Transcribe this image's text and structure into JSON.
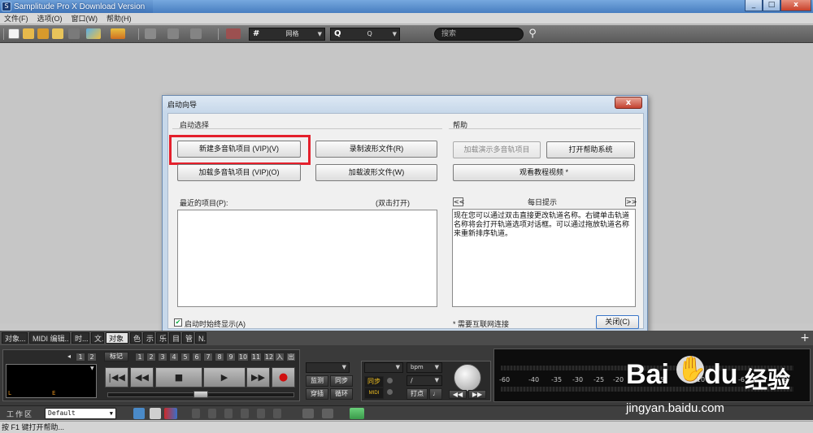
{
  "window": {
    "title": "Samplitude Pro X Download Version",
    "controls": [
      "_",
      "□",
      "x"
    ]
  },
  "menu": [
    "文件(F)",
    "选项(O)",
    "窗口(W)",
    "帮助(H)"
  ],
  "toolbar": {
    "grid_label": "网格",
    "grid_glyph": "#",
    "quantize_label": "Q",
    "quantize_glyph": "Q",
    "search_placeholder": "搜索"
  },
  "dialog": {
    "title": "启动向导",
    "close_label": "x",
    "start_group": "启动选择",
    "help_group": "帮助",
    "buttons": {
      "new_multitrack": "新建多音轨项目 (VIP)(V)",
      "record_wave": "录制波形文件(R)",
      "load_multitrack": "加载多音轨项目 (VIP)(O)",
      "load_wave": "加载波形文件(W)",
      "load_demo": "加载演示多音轨项目",
      "open_help": "打开帮助系统",
      "watch_tutorial": "观看教程视频 *",
      "close": "关闭(C)"
    },
    "recent_label": "最近的项目(P):",
    "recent_hint": "(双击打开)",
    "tip_title": "每日提示",
    "tip_prev": "<<",
    "tip_next": ">>",
    "tip_text": "现在您可以通过双击直接更改轨道名称。右键单击轨道名称将会打开轨道选项对话框。可以通过拖放轨道名称来重新排序轨道。",
    "show_on_start_label": "启动时始终显示(A)",
    "show_on_start_checked": true,
    "internet_note": "* 需要互联网连接"
  },
  "tabs": [
    "对象...",
    "MIDI 编辑...",
    "时...",
    "文...",
    "对象",
    "色...",
    "示...",
    "乐...",
    "目...",
    "管...",
    "N..."
  ],
  "transport": {
    "marker_numbers": [
      "1",
      "2"
    ],
    "marker_label": "标记",
    "marker_slots": [
      "1",
      "2",
      "3",
      "4",
      "5",
      "6",
      "7",
      "8",
      "9",
      "10",
      "11",
      "12"
    ],
    "in_label": "入",
    "out_label": "出",
    "display_left": "L",
    "display_right": "E",
    "buttons": [
      "|◀◀",
      "◀◀",
      "■",
      "▶",
      "▶▶",
      "●"
    ],
    "monitor_label": "监测",
    "sync_label": "同步",
    "punch_label": "穿插",
    "loop_label": "循环",
    "sync_small": "同步",
    "midi_small": "MIDI",
    "bpm_label": "bpm",
    "slash_label": "/",
    "click_label": "打点",
    "meter_ticks": [
      "-60",
      "-40",
      "-35",
      "-30",
      "-25",
      "-20",
      "-15",
      "-10",
      "-6",
      "9"
    ]
  },
  "workspace": {
    "label": "工作区",
    "value": "Default"
  },
  "status": "按 F1 键打开帮助...",
  "watermark": {
    "brand": "Bai",
    "brand2": "du",
    "cn": "经验",
    "url": "jingyan.baidu.com"
  },
  "colors": {
    "highlight": "#e4202c",
    "dialog_bg": "#c7d8ea",
    "record": "#d01010"
  }
}
